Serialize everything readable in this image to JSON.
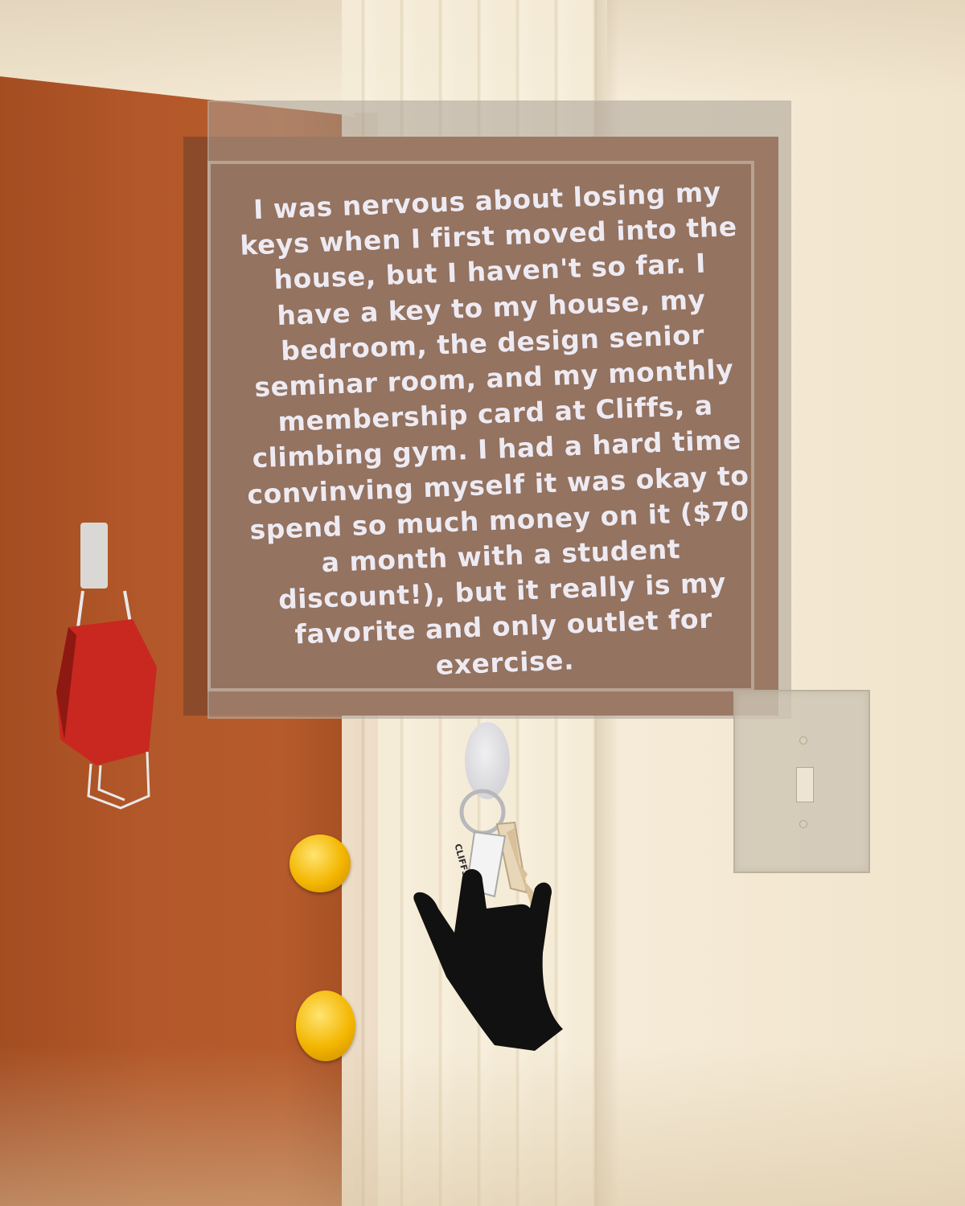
{
  "plaque": {
    "text": "I was nervous about losing my keys when I first moved into the house, but I haven't so far. I have a key to my house, my bedroom, the design senior seminar room, and my monthly membership card at Cliffs, a climbing gym. I had a hard time convinving myself it was okay to spend so much money on it ($70 a month with a student discount!), but it really is my favorite and only outlet for exercise."
  },
  "keychain": {
    "card_label": "CLIFFS"
  },
  "colors": {
    "door": "#b3582a",
    "wall": "#f3e6cf",
    "plaque_board": "#7a3d1f",
    "plaque_text": "#eeeaf2",
    "mask": "#c8281f",
    "knob": "#f3b600",
    "glove": "#111111"
  },
  "icons": {
    "mask": "face-mask-icon",
    "keys": "keys-icon",
    "glove": "hand-glove-icon",
    "switch": "light-switch-icon"
  }
}
